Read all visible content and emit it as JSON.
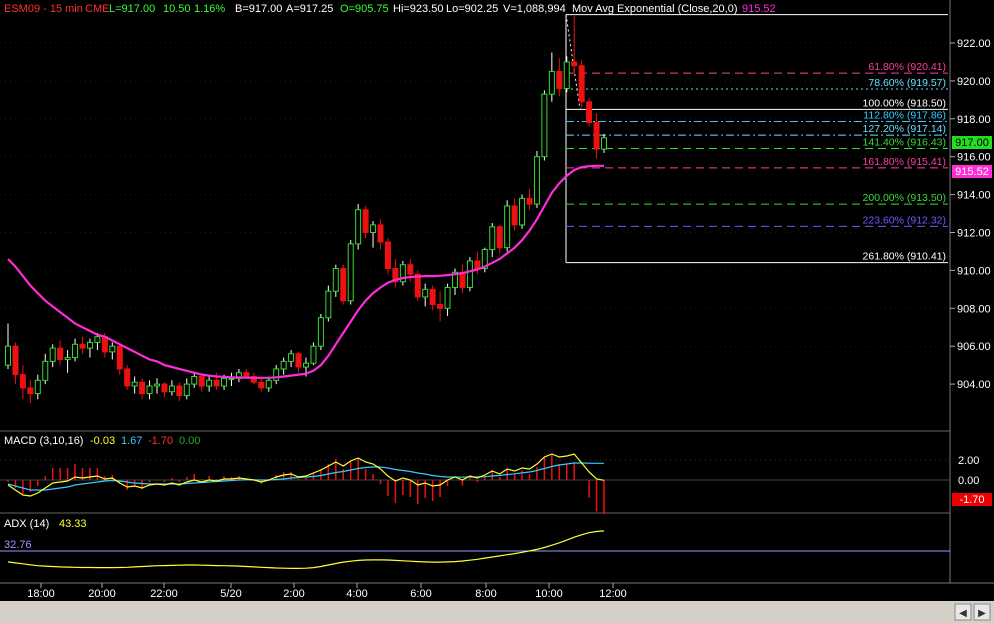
{
  "header": {
    "symbol": "ESM09 - 15 min",
    "exchange": "CME",
    "last": "L=917.00",
    "change": "10.50",
    "change_pct": "1.16%",
    "bid": "B=917.00",
    "ask": "A=917.25",
    "open": "O=905.75",
    "high": "Hi=923.50",
    "low": "Lo=902.25",
    "volume": "V=1,088,994",
    "indicator": "Mov Avg Exponential (Close,20,0)",
    "indicator_value": "915.52"
  },
  "price_axis": {
    "ticks": [
      "922.00",
      "920.00",
      "918.00",
      "916.00",
      "914.00",
      "912.00",
      "910.00",
      "908.00",
      "906.00",
      "904.00"
    ],
    "last_price_label": "917.00",
    "ema_label": "915.52"
  },
  "fibonacci": [
    {
      "label": "61.80% (920.41)",
      "price": 920.41,
      "color": "#ff3fa0",
      "style": "dash"
    },
    {
      "label": "78.60% (919.57)",
      "price": 919.57,
      "color": "#66e0ff",
      "style": "dot"
    },
    {
      "label": "100.00% (918.50)",
      "price": 918.5,
      "color": "#ffffff",
      "style": "solid"
    },
    {
      "label": "112.80% (917.86)",
      "price": 917.86,
      "color": "#33ccff",
      "style": "dashdot"
    },
    {
      "label": "127.20% (917.14)",
      "price": 917.14,
      "color": "#66e0ff",
      "style": "dashdot"
    },
    {
      "label": "141.40% (916.43)",
      "price": 916.43,
      "color": "#33dd33",
      "style": "dash"
    },
    {
      "label": "161.80% (915.41)",
      "price": 915.41,
      "color": "#ff3fa0",
      "style": "dash"
    },
    {
      "label": "200.00% (913.50)",
      "price": 913.5,
      "color": "#33dd33",
      "style": "dash"
    },
    {
      "label": "223.60% (912.32)",
      "price": 912.32,
      "color": "#6a5cff",
      "style": "dash"
    },
    {
      "label": "261.80% (910.41)",
      "price": 910.41,
      "color": "#ffffff",
      "style": "solid"
    }
  ],
  "macd": {
    "title": "MACD (3,10,16)",
    "v1": "-0.03",
    "v2": "1.67",
    "v3": "-1.70",
    "v4": "0.00",
    "ticks": [
      "2.00",
      "0.00"
    ],
    "last_label": "-1.70"
  },
  "adx": {
    "title": "ADX (14)",
    "value": "43.33",
    "level": "32.76"
  },
  "time_axis": [
    "18:00",
    "20:00",
    "22:00",
    "5/20",
    "2:00",
    "4:00",
    "6:00",
    "8:00",
    "10:00",
    "12:00"
  ],
  "chart_data": {
    "type": "candlestick",
    "interval": "15 min",
    "ylim": [
      902,
      924
    ],
    "candles_ohlc": [
      [
        905.0,
        907.2,
        904.8,
        906.0
      ],
      [
        906.0,
        906.2,
        904.0,
        904.5
      ],
      [
        904.5,
        905.0,
        903.2,
        903.8
      ],
      [
        903.8,
        904.2,
        903.0,
        903.5
      ],
      [
        903.5,
        904.5,
        903.2,
        904.2
      ],
      [
        904.2,
        905.6,
        904.0,
        905.2
      ],
      [
        905.2,
        906.1,
        904.9,
        905.9
      ],
      [
        905.9,
        906.3,
        905.0,
        905.3
      ],
      [
        905.3,
        905.8,
        904.6,
        905.4
      ],
      [
        905.4,
        906.4,
        905.2,
        906.1
      ],
      [
        906.1,
        906.5,
        905.6,
        905.9
      ],
      [
        905.9,
        906.4,
        905.4,
        906.2
      ],
      [
        906.2,
        906.7,
        905.8,
        906.5
      ],
      [
        906.5,
        906.7,
        905.4,
        905.7
      ],
      [
        905.7,
        906.2,
        905.3,
        906.0
      ],
      [
        906.0,
        906.1,
        904.5,
        904.8
      ],
      [
        904.8,
        905.0,
        903.7,
        903.9
      ],
      [
        903.9,
        904.4,
        903.5,
        904.1
      ],
      [
        904.1,
        904.3,
        903.2,
        903.5
      ],
      [
        903.5,
        904.2,
        903.2,
        903.9
      ],
      [
        903.9,
        904.3,
        903.5,
        904.0
      ],
      [
        904.0,
        904.1,
        903.3,
        903.6
      ],
      [
        903.6,
        904.2,
        903.4,
        903.9
      ],
      [
        903.9,
        904.1,
        903.1,
        903.4
      ],
      [
        903.4,
        904.3,
        903.2,
        904.0
      ],
      [
        904.0,
        904.6,
        903.8,
        904.4
      ],
      [
        904.4,
        904.5,
        903.6,
        903.9
      ],
      [
        903.9,
        904.4,
        903.6,
        904.2
      ],
      [
        904.2,
        904.6,
        903.7,
        903.9
      ],
      [
        903.9,
        904.5,
        903.7,
        904.3
      ],
      [
        904.3,
        904.6,
        903.9,
        904.3
      ],
      [
        904.3,
        904.8,
        904.1,
        904.6
      ],
      [
        904.6,
        904.8,
        904.3,
        904.4
      ],
      [
        904.4,
        904.6,
        904.0,
        904.1
      ],
      [
        904.1,
        904.4,
        903.6,
        903.8
      ],
      [
        903.8,
        904.4,
        903.6,
        904.2
      ],
      [
        904.2,
        905.0,
        904.0,
        904.8
      ],
      [
        904.8,
        905.4,
        904.5,
        905.2
      ],
      [
        905.2,
        905.8,
        904.9,
        905.6
      ],
      [
        905.6,
        905.7,
        904.6,
        904.9
      ],
      [
        904.9,
        905.4,
        904.4,
        905.1
      ],
      [
        905.1,
        906.2,
        905.0,
        906.0
      ],
      [
        906.0,
        907.7,
        905.8,
        907.5
      ],
      [
        907.5,
        909.2,
        907.3,
        908.9
      ],
      [
        908.9,
        910.3,
        908.6,
        910.1
      ],
      [
        910.1,
        910.3,
        908.2,
        908.4
      ],
      [
        908.4,
        911.6,
        908.2,
        911.4
      ],
      [
        911.4,
        913.5,
        911.1,
        913.2
      ],
      [
        913.2,
        913.4,
        911.7,
        912.0
      ],
      [
        912.0,
        912.6,
        911.2,
        912.4
      ],
      [
        912.4,
        912.7,
        911.1,
        911.5
      ],
      [
        911.5,
        911.7,
        909.8,
        910.1
      ],
      [
        910.1,
        910.6,
        909.1,
        909.4
      ],
      [
        909.4,
        910.5,
        909.2,
        910.3
      ],
      [
        910.3,
        910.6,
        909.4,
        909.8
      ],
      [
        909.8,
        910.0,
        908.4,
        908.6
      ],
      [
        908.6,
        909.3,
        908.1,
        909.0
      ],
      [
        909.0,
        909.2,
        907.9,
        908.2
      ],
      [
        908.2,
        908.9,
        907.3,
        908.0
      ],
      [
        908.0,
        909.3,
        907.6,
        909.1
      ],
      [
        909.1,
        910.1,
        908.7,
        909.9
      ],
      [
        909.9,
        910.3,
        908.8,
        909.1
      ],
      [
        909.1,
        910.7,
        908.9,
        910.5
      ],
      [
        910.5,
        911.0,
        909.8,
        910.1
      ],
      [
        910.1,
        911.2,
        909.9,
        911.1
      ],
      [
        911.1,
        912.5,
        910.7,
        912.3
      ],
      [
        912.3,
        912.4,
        910.9,
        911.2
      ],
      [
        911.2,
        913.7,
        911.0,
        913.4
      ],
      [
        913.4,
        913.8,
        912.1,
        912.4
      ],
      [
        912.4,
        914.0,
        912.2,
        913.8
      ],
      [
        913.8,
        914.3,
        913.2,
        913.5
      ],
      [
        913.5,
        916.3,
        913.3,
        916.0
      ],
      [
        916.0,
        919.5,
        915.8,
        919.3
      ],
      [
        919.3,
        921.5,
        918.9,
        920.5
      ],
      [
        920.5,
        921.2,
        919.2,
        919.6
      ],
      [
        919.6,
        921.3,
        919.4,
        921.0
      ],
      [
        921.0,
        923.5,
        920.4,
        920.8
      ],
      [
        920.8,
        921.1,
        918.6,
        918.9
      ],
      [
        918.9,
        919.1,
        917.6,
        917.8
      ],
      [
        917.8,
        918.3,
        915.9,
        916.4
      ],
      [
        916.4,
        917.2,
        916.2,
        917.0
      ]
    ],
    "ema_20": [
      910.6,
      910.2,
      909.7,
      909.2,
      908.8,
      908.4,
      908.1,
      907.8,
      907.5,
      907.2,
      907.0,
      906.8,
      906.6,
      906.5,
      906.3,
      906.1,
      905.9,
      905.7,
      905.5,
      905.3,
      905.2,
      905.0,
      904.9,
      904.8,
      904.7,
      904.6,
      904.5,
      904.45,
      904.4,
      904.38,
      904.36,
      904.35,
      904.34,
      904.33,
      904.33,
      904.33,
      904.36,
      904.4,
      904.45,
      904.5,
      904.55,
      904.7,
      905.0,
      905.5,
      906.1,
      906.7,
      907.3,
      907.9,
      908.4,
      908.8,
      909.1,
      909.35,
      909.5,
      909.6,
      909.65,
      909.68,
      909.7,
      909.7,
      909.72,
      909.75,
      909.8,
      909.85,
      909.95,
      910.05,
      910.2,
      910.4,
      910.6,
      910.9,
      911.2,
      911.6,
      912.1,
      912.7,
      913.4,
      914.1,
      914.6,
      915.0,
      915.3,
      915.45,
      915.5,
      915.52,
      915.52
    ],
    "macd_line": [
      -0.5,
      -1.0,
      -1.5,
      -1.6,
      -1.3,
      -0.8,
      -0.3,
      -0.2,
      -0.1,
      0.3,
      0.2,
      0.3,
      0.4,
      0.1,
      0.2,
      -0.3,
      -0.7,
      -0.6,
      -0.8,
      -0.5,
      -0.4,
      -0.5,
      -0.3,
      -0.5,
      -0.2,
      0.0,
      -0.2,
      0.0,
      -0.1,
      0.1,
      0.1,
      0.2,
      0.1,
      0.0,
      -0.2,
      0.0,
      0.3,
      0.5,
      0.6,
      0.3,
      0.4,
      0.7,
      1.0,
      1.4,
      1.8,
      1.4,
      1.9,
      2.2,
      1.8,
      1.6,
      1.1,
      0.4,
      -0.1,
      0.2,
      0.0,
      -0.5,
      -0.3,
      -0.6,
      -0.5,
      0.0,
      0.3,
      0.0,
      0.4,
      0.2,
      0.5,
      0.9,
      0.6,
      1.1,
      0.9,
      1.2,
      1.1,
      1.6,
      2.3,
      2.6,
      2.3,
      2.4,
      2.6,
      1.7,
      0.8,
      0.1,
      -0.03
    ],
    "macd_signal": [
      -0.4,
      -0.6,
      -0.8,
      -1.0,
      -1.0,
      -1.0,
      -0.9,
      -0.8,
      -0.7,
      -0.5,
      -0.4,
      -0.3,
      -0.2,
      -0.1,
      -0.05,
      -0.1,
      -0.2,
      -0.3,
      -0.35,
      -0.4,
      -0.4,
      -0.4,
      -0.4,
      -0.4,
      -0.35,
      -0.3,
      -0.25,
      -0.2,
      -0.15,
      -0.1,
      -0.05,
      0.0,
      0.02,
      0.02,
      0.0,
      0.0,
      0.05,
      0.1,
      0.2,
      0.25,
      0.3,
      0.35,
      0.45,
      0.6,
      0.75,
      0.85,
      1.0,
      1.15,
      1.25,
      1.3,
      1.3,
      1.2,
      1.05,
      0.95,
      0.85,
      0.7,
      0.6,
      0.45,
      0.35,
      0.3,
      0.3,
      0.28,
      0.3,
      0.3,
      0.33,
      0.4,
      0.45,
      0.55,
      0.62,
      0.72,
      0.8,
      0.95,
      1.15,
      1.35,
      1.5,
      1.6,
      1.7,
      1.7,
      1.68,
      1.67,
      1.67
    ],
    "adx_14": [
      27.0,
      26.5,
      26.0,
      25.5,
      25.0,
      24.8,
      24.6,
      24.4,
      24.3,
      24.2,
      24.1,
      24.1,
      24.0,
      24.0,
      24.0,
      24.1,
      24.2,
      24.4,
      24.6,
      24.8,
      25.0,
      25.1,
      25.2,
      25.3,
      25.4,
      25.4,
      25.3,
      25.2,
      25.1,
      25.0,
      24.9,
      24.8,
      24.6,
      24.4,
      24.2,
      24.0,
      23.8,
      23.7,
      23.6,
      23.6,
      23.7,
      24.0,
      24.6,
      25.4,
      26.2,
      26.9,
      27.4,
      27.8,
      28.0,
      28.1,
      28.1,
      28.0,
      27.8,
      27.6,
      27.4,
      27.2,
      27.0,
      26.9,
      26.9,
      27.0,
      27.2,
      27.5,
      27.9,
      28.4,
      29.0,
      29.6,
      30.2,
      30.8,
      31.4,
      32.1,
      32.8,
      33.6,
      34.6,
      35.8,
      37.1,
      38.5,
      40.0,
      41.3,
      42.4,
      43.0,
      43.33
    ],
    "adx_level": 32.76
  }
}
